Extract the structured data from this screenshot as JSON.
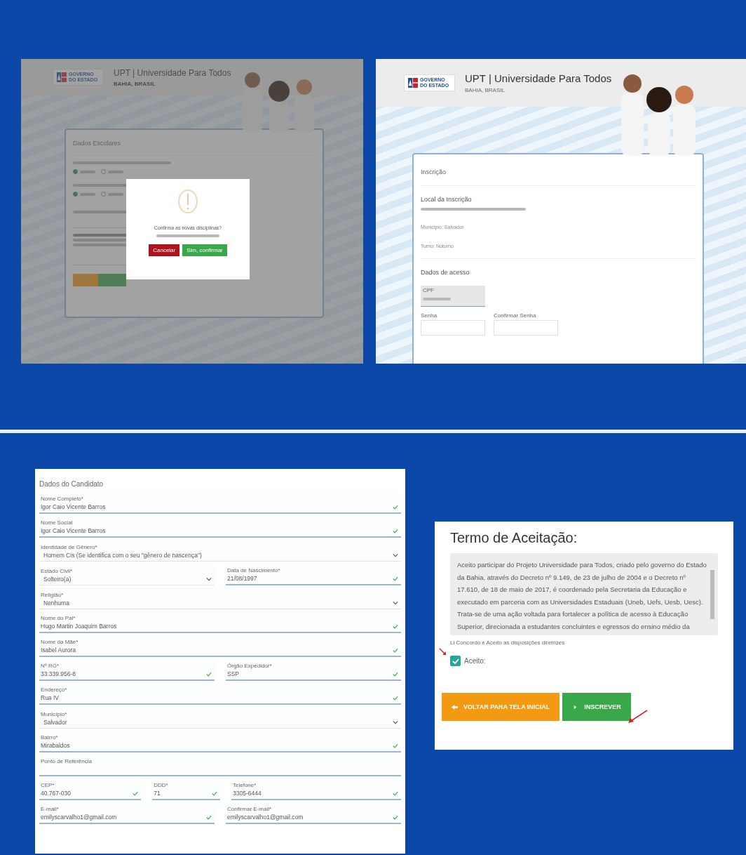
{
  "modal_screen": {
    "header": {
      "logo_text": "GOVERNO DO ESTADO",
      "title": "UPT | Universidade Para Todos",
      "subtitle": "BAHIA, BRASIL"
    },
    "card_title": "Dados Escolares",
    "radio_groups": [
      {
        "options": [
          {
            "selected": true
          },
          {
            "selected": false
          }
        ]
      },
      {
        "options": [
          {
            "selected": true
          },
          {
            "selected": false
          }
        ]
      }
    ],
    "modal": {
      "question": "Confirma as novas disciplinas?",
      "buttons": [
        {
          "label": "Cancelar",
          "kind": "danger"
        },
        {
          "label": "Sim, confirmar",
          "kind": "success"
        }
      ]
    },
    "form_buttons": [
      {
        "kind": "warning"
      },
      {
        "kind": "success"
      }
    ]
  },
  "inscricao_screen": {
    "header": {
      "logo_text": "GOVERNO DO ESTADO",
      "title": "UPT | Universidade Para Todos",
      "subtitle": "BAHIA, BRASIL"
    },
    "section_title": "Inscrição",
    "local_title": "Local da Inscrição",
    "details": [
      "Município: Salvador",
      "Turno: Noturno"
    ],
    "access_title": "Dados de acesso",
    "cpf_label": "CPF",
    "password_fields": [
      "Senha",
      "Confirmar Senha"
    ]
  },
  "candidate_form": {
    "title": "Dados do Candidato",
    "rows": [
      {
        "fields": [
          {
            "label": "Nome Completo*",
            "value": "Igor Caio Vicente Barros",
            "kind": "text",
            "valid": true
          }
        ]
      },
      {
        "fields": [
          {
            "label": "Nome Social",
            "value": "Igor Caio Vicente Barros",
            "kind": "text",
            "valid": true
          }
        ]
      },
      {
        "fields": [
          {
            "label": "Identidade de Gênero*",
            "value": "Homem Cis (Se identifica com o seu \"gênero de nascença\")",
            "kind": "select"
          }
        ]
      },
      {
        "fields": [
          {
            "label": "Estado Civil*",
            "value": "Solteiro(a)",
            "kind": "select"
          },
          {
            "label": "Data de Nascimento*",
            "value": "21/08/1997",
            "kind": "text",
            "valid": true
          }
        ]
      },
      {
        "fields": [
          {
            "label": "Religião*",
            "value": "Nenhuma",
            "kind": "select"
          }
        ]
      },
      {
        "fields": [
          {
            "label": "Nome do Pai*",
            "value": "Hugo Martin Joaquim Barros",
            "kind": "text",
            "valid": true
          }
        ]
      },
      {
        "fields": [
          {
            "label": "Nome da Mãe*",
            "value": "Isabel Aurora",
            "kind": "text",
            "valid": true
          }
        ]
      },
      {
        "fields": [
          {
            "label": "Nº RG*",
            "value": "33.339.956-8",
            "kind": "text",
            "valid": true
          },
          {
            "label": "Órgão Expedidor*",
            "value": "SSP",
            "kind": "text",
            "valid": true
          }
        ]
      },
      {
        "fields": [
          {
            "label": "Endereço*",
            "value": "Rua IV",
            "kind": "text",
            "valid": true
          }
        ]
      },
      {
        "fields": [
          {
            "label": "Município*",
            "value": "Salvador",
            "kind": "select"
          }
        ]
      },
      {
        "fields": [
          {
            "label": "Bairro*",
            "value": "Mirabaldos",
            "kind": "text",
            "valid": true
          }
        ]
      },
      {
        "fields": [
          {
            "label": "Ponto de Referência",
            "kind": "text",
            "valid": false
          }
        ]
      },
      {
        "fields": [
          {
            "label": "CEP*",
            "value": "40.767-030",
            "kind": "text",
            "valid": true
          },
          {
            "label": "DDD*",
            "value": "71",
            "kind": "text",
            "valid": true
          },
          {
            "label": "Telefone*",
            "value": "3305-6444",
            "kind": "text",
            "valid": true
          }
        ]
      },
      {
        "fields": [
          {
            "label": "E-mail*",
            "value": "emilyscarvalho1@gmail.com",
            "kind": "text",
            "valid": true
          },
          {
            "label": "Confirmar E-mail*",
            "value": "emilyscarvalho1@gmail.com",
            "kind": "text",
            "valid": true
          }
        ]
      }
    ]
  },
  "terms": {
    "title": "Termo de Aceitação:",
    "text": "Aceito participar do Projeto Universidade para Todos, criado pelo governo do Estado da Bahia, através do Decreto nº 9.149, de 23 de julho de 2004 e o Decreto nº 17.610, de 18 de maio de 2017, é coordenado pela Secretaria da Educação e executado em parceria com as Universidades Estaduais (Uneb, Uefs, Uesb, Uesc). Trata-se de uma ação voltada para fortalecer a política de acesso à Educação Superior, direcionada a estudantes concluintes e egressos do ensino médio da",
    "agreement": "Li Concordo e Aceito as disposições diretrizes",
    "accept": {
      "label": "Aceito:",
      "checked": true
    },
    "buttons": [
      {
        "label": "VOLTAR PARA TELA INICIAL",
        "kind": "warning"
      },
      {
        "label": "INSCREVER",
        "kind": "success"
      }
    ]
  }
}
